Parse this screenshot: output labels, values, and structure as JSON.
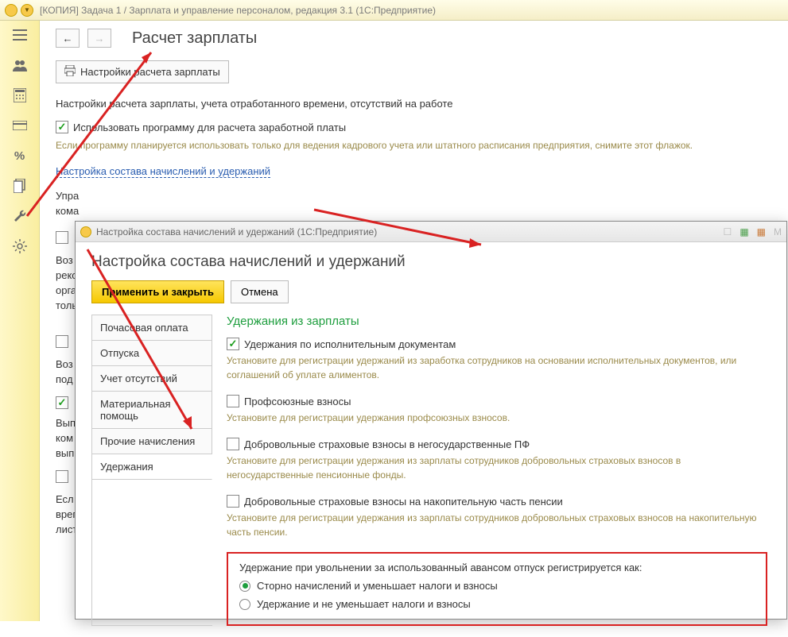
{
  "window": {
    "title": "[КОПИЯ] Задача 1 / Зарплата и управление персоналом, редакция 3.1  (1С:Предприятие)"
  },
  "page": {
    "title": "Расчет зарплаты",
    "settings_btn": "Настройки расчета зарплаты",
    "description": "Настройки расчета зарплаты, учета отработанного времени, отсутствий на работе",
    "use_program_label": "Использовать программу для расчета заработной платы",
    "use_program_hint": "Если программу планируется использовать только для ведения кадрового учета или штатного расписания предприятия, снимите этот флажок.",
    "settings_link": "Настройка состава начислений и удержаний",
    "partial1": "Упра",
    "partial2": "кома"
  },
  "modal": {
    "title": "Настройка состава начислений и удержаний  (1С:Предприятие)",
    "heading": "Настройка состава начислений и удержаний",
    "apply_close": "Применить и закрыть",
    "cancel": "Отмена",
    "tabs": [
      "Почасовая оплата",
      "Отпуска",
      "Учет отсутствий",
      "Материальная помощь",
      "Прочие начисления",
      "Удержания"
    ],
    "active_tab": 5,
    "section_title": "Удержания из зарплаты",
    "opts": [
      {
        "label": "Удержания по исполнительным документам",
        "checked": true,
        "hint": "Установите для регистрации удержаний из заработка сотрудников на основании исполнительных документов, или соглашений об уплате алиментов."
      },
      {
        "label": "Профсоюзные взносы",
        "checked": false,
        "hint": "Установите для регистрации удержания профсоюзных взносов."
      },
      {
        "label": "Добровольные страховые взносы в негосударственные ПФ",
        "checked": false,
        "hint": "Установите для регистрации удержания из зарплаты сотрудников добровольных страховых взносов в негосударственные пенсионные фонды."
      },
      {
        "label": "Добровольные страховые взносы на накопительную часть пенсии",
        "checked": false,
        "hint": "Установите для регистрации удержания из зарплаты сотрудников добровольных страховых взносов на накопительную часть пенсии."
      }
    ],
    "radio_head": "Удержание при увольнении за использованный авансом отпуск регистрируется как:",
    "radios": [
      {
        "label": "Сторно начислений и уменьшает налоги и взносы",
        "selected": true
      },
      {
        "label": "Удержание и не уменьшает налоги и взносы",
        "selected": false
      }
    ],
    "win_icons": {
      "m_label": "M"
    }
  },
  "bg": {
    "p1": "Воз",
    "p2": "реко",
    "p3": "орга",
    "p4": "толь",
    "p5": "Воз",
    "p6": "под",
    "p7": "Вып",
    "p8": "ком",
    "p9": "вып",
    "p10": "Есл",
    "p11": "врег",
    "p12": "лист"
  }
}
